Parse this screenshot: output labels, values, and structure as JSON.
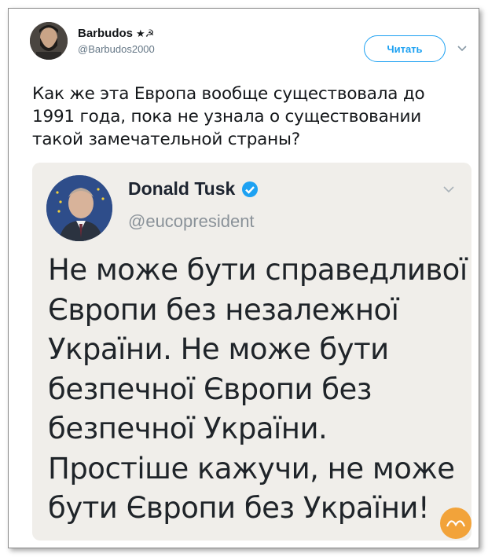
{
  "tweet": {
    "author_name": "Barbudos",
    "author_emoji": "★☭",
    "author_handle": "@Barbudos2000",
    "follow_label": "Читать",
    "text_lines": [
      "Как же эта Европа вообще существовала до",
      "1991 года, пока не узнала о существовании",
      "такой замечательной страны?"
    ]
  },
  "quoted": {
    "author_name": "Donald Tusk",
    "author_handle": "@eucopresident",
    "text_lines": [
      "Не може бути справедливої",
      "Європи без незалежної",
      "України. Не може бути",
      "безпечної Європи без",
      "безпечної України.",
      "Простіше кажучи, не може",
      "бути Європи без України!"
    ]
  },
  "colors": {
    "accent": "#1da1f2",
    "embed_background": "#f0eeea",
    "watermark": "#f2a33a"
  },
  "icons": {
    "verified": "verified-badge-icon",
    "caret": "chevron-down-icon"
  }
}
